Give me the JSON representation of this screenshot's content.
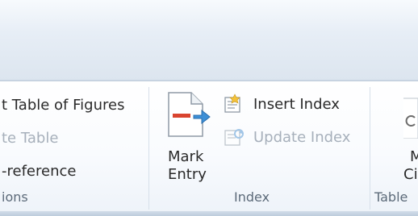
{
  "ribbon": {
    "captions_group": {
      "items": [
        {
          "label": "t Table of Figures",
          "enabled": true
        },
        {
          "label": "te Table",
          "enabled": false
        },
        {
          "label": "-reference",
          "enabled": true
        }
      ],
      "group_label": "ions"
    },
    "index_group": {
      "mark_entry": {
        "label_line1": "Mark",
        "label_line2": "Entry"
      },
      "insert_index": {
        "label": "Insert Index",
        "enabled": true
      },
      "update_index": {
        "label": "Update Index",
        "enabled": false
      },
      "group_label": "Index"
    },
    "toa_group": {
      "partial_label_line1": "M",
      "partial_label_line2": "Ci",
      "group_label": "Table"
    }
  },
  "icons": {
    "mark_entry": "mark-entry-icon",
    "insert_index": "insert-index-icon",
    "update_index": "update-index-icon",
    "mark_citation": "mark-citation-icon"
  },
  "colors": {
    "ribbon_band": "#dce5ef",
    "disabled_text": "#a7b0bb",
    "group_label_text": "#5c6a79",
    "accent_red": "#d9442f",
    "accent_blue": "#3d8fd6"
  }
}
